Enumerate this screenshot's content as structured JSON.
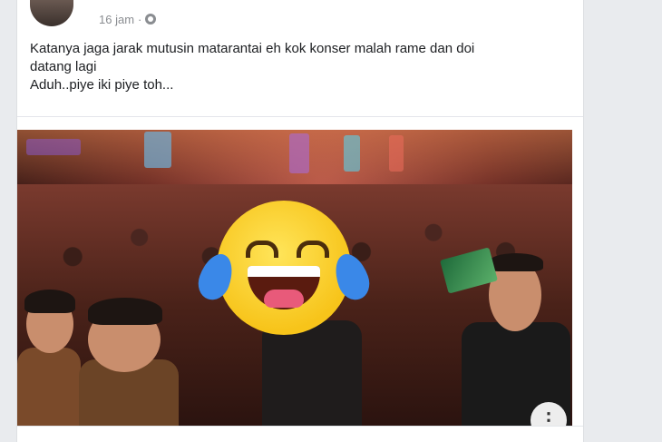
{
  "post": {
    "time": "16 jam",
    "separator": "·",
    "privacy_icon": "globe-icon",
    "text_line1": "Katanya jaga jarak mutusin matarantai eh kok konser malah rame dan doi",
    "text_line2": "datang lagi",
    "text_line3": "Aduh..piye iki piye toh..."
  },
  "photo": {
    "overlay_icon": "laughing-tears-emoji",
    "more_icon": "more-options-icon",
    "more_glyph": "⋮"
  },
  "colors": {
    "page_bg": "#e9ebee",
    "card_bg": "#ffffff",
    "text": "#1c1e21",
    "meta": "#8a8d91"
  }
}
